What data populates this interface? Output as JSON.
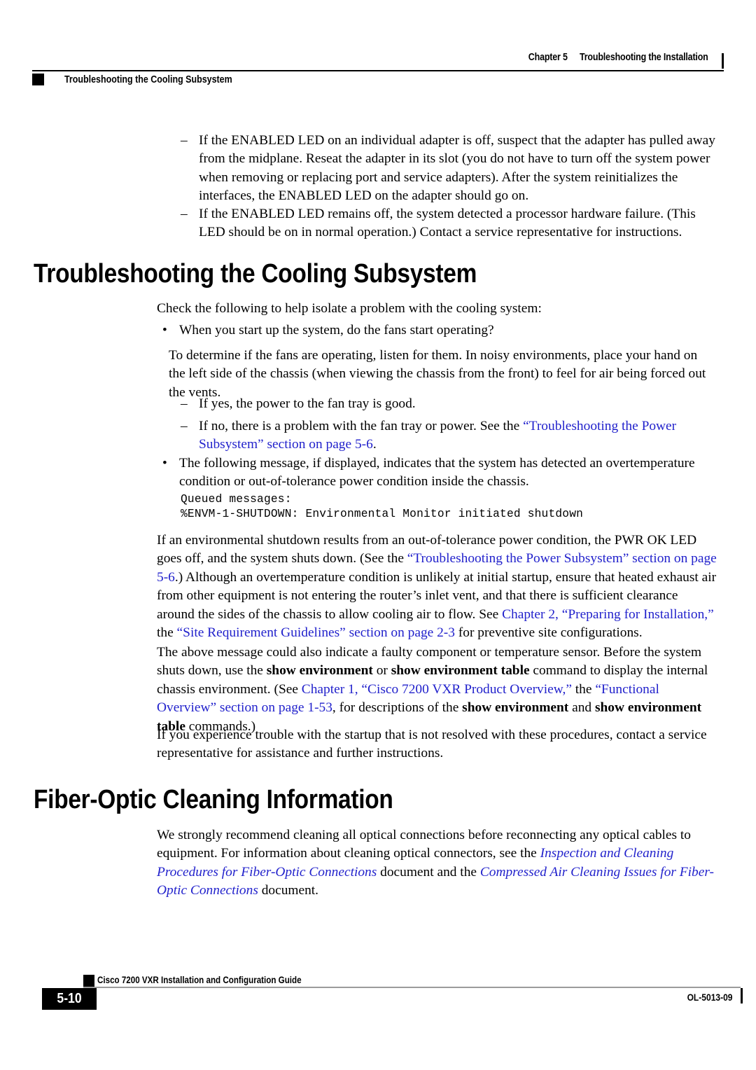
{
  "header": {
    "chapter_label": "Chapter 5",
    "chapter_title": "Troubleshooting the Installation",
    "running_head": "Troubleshooting the Cooling Subsystem"
  },
  "content": {
    "dash_item_1": "If the ENABLED LED on an individual adapter is off, suspect that the adapter has pulled away from the midplane. Reseat the adapter in its slot (you do not have to turn off the system power when removing or replacing port and service adapters). After the system reinitializes the interfaces, the ENABLED LED on the adapter should go on.",
    "dash_item_2": "If the ENABLED LED remains off, the system detected a processor hardware failure. (This LED should be on in normal operation.) Contact a service representative for instructions.",
    "heading_cooling": "Troubleshooting the Cooling Subsystem",
    "intro_cooling": "Check the following to help isolate a problem with the cooling system:",
    "bullet_fans": "When you start up the system, do the fans start operating?",
    "para_determine": "To determine if the fans are operating, listen for them. In noisy environments, place your hand on the left side of the chassis (when viewing the chassis from the front) to feel for air being forced out the vents.",
    "dash_yes": "If yes, the power to the fan tray is good.",
    "dash_no_pre": "If no, there is a problem with the fan tray or power. See the ",
    "dash_no_link": "“Troubleshooting the Power Subsystem” section on page 5-6",
    "dash_no_post": ".",
    "bullet_message": "The following message, if displayed, indicates that the system has detected an overtemperature condition or out-of-tolerance power condition inside the chassis.",
    "code_line_1": "Queued messages:",
    "code_line_2": "%ENVM-1-SHUTDOWN: Environmental Monitor initiated shutdown",
    "para_shutdown_1": "If an environmental shutdown results from an out-of-tolerance power condition, the PWR OK LED goes off, and the system shuts down. (See the ",
    "para_shutdown_link1": "“Troubleshooting the Power Subsystem” section on page 5-6",
    "para_shutdown_2": ".) Although an overtemperature condition is unlikely at initial startup, ensure that heated exhaust air from other equipment is not entering the router’s inlet vent, and that there is sufficient clearance around the sides of the chassis to allow cooling air to flow. See ",
    "para_shutdown_link2": "Chapter 2, “Preparing for Installation,”",
    "para_shutdown_3": " the ",
    "para_shutdown_link3": "“Site Requirement Guidelines” section on page 2-3",
    "para_shutdown_4": " for preventive site configurations.",
    "para_faulty_1": "The above message could also indicate a faulty component or temperature sensor. Before the system shuts down, use the ",
    "para_faulty_b1": "show environment",
    "para_faulty_2": " or ",
    "para_faulty_b2": "show environment table",
    "para_faulty_3": " command to display the internal chassis environment. (See ",
    "para_faulty_link1": "Chapter 1, “Cisco 7200 VXR Product Overview,”",
    "para_faulty_4": " the ",
    "para_faulty_link2": "“Functional Overview” section on page 1-53",
    "para_faulty_5": ", for descriptions of the ",
    "para_faulty_b3": "show environment",
    "para_faulty_6": " and ",
    "para_faulty_b4": "show environment table",
    "para_faulty_7": " commands.)",
    "para_trouble": "If you experience trouble with the startup that is not resolved with these procedures, contact a service representative for assistance and further instructions.",
    "heading_fiber": "Fiber-Optic Cleaning Information",
    "para_fiber_1": "We strongly recommend cleaning all optical connections before reconnecting any optical cables to equipment. For information about cleaning optical connectors, see the ",
    "para_fiber_link1": "Inspection and Cleaning Procedures for Fiber-Optic Connections",
    "para_fiber_2": " document and the ",
    "para_fiber_link2": "Compressed Air Cleaning Issues for Fiber-Optic Connections",
    "para_fiber_3": " document.",
    "dash_marker": "–",
    "bullet_marker": "•"
  },
  "footer": {
    "guide_title": "Cisco 7200 VXR Installation and Configuration Guide",
    "page_number": "5-10",
    "doc_id": "OL-5013-09"
  },
  "colors": {
    "link": "#2222cc",
    "text": "#000000",
    "footer_rule": "#9b9b9b"
  }
}
